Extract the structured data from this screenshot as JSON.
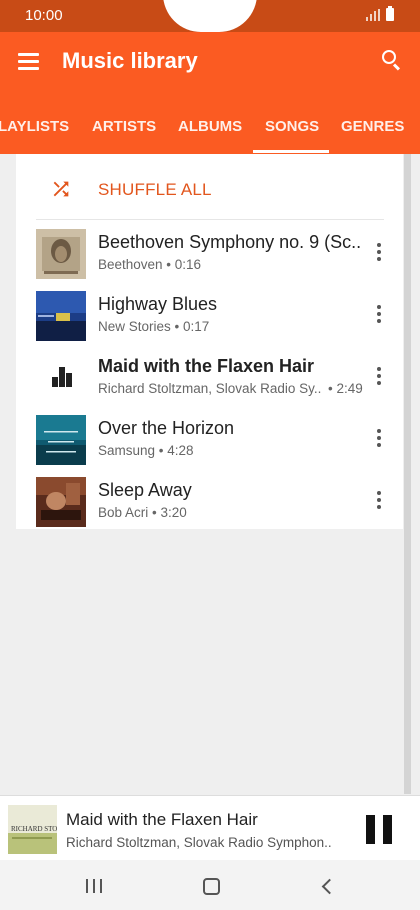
{
  "status_bar": {
    "time": "10:00"
  },
  "app_bar": {
    "title": "Music library",
    "tabs": [
      {
        "label": "LAYLISTS",
        "active": false
      },
      {
        "label": "ARTISTS",
        "active": false
      },
      {
        "label": "ALBUMS",
        "active": false
      },
      {
        "label": "SONGS",
        "active": true
      },
      {
        "label": "GENRES",
        "active": false
      }
    ]
  },
  "shuffle": {
    "label": "SHUFFLE ALL"
  },
  "songs": [
    {
      "title": "Beethoven Symphony no. 9 (Sc..",
      "subtitle": "Beethoven • 0:16",
      "duration": "",
      "playing": false
    },
    {
      "title": "Highway Blues",
      "subtitle": "New Stories • 0:17",
      "duration": "",
      "playing": false
    },
    {
      "title": "Maid with the Flaxen Hair",
      "subtitle": "Richard Stoltzman, Slovak Radio Sy..",
      "duration": "• 2:49",
      "playing": true
    },
    {
      "title": "Over the Horizon",
      "subtitle": "Samsung • 4:28",
      "duration": "",
      "playing": false
    },
    {
      "title": "Sleep Away",
      "subtitle": "Bob Acri • 3:20",
      "duration": "",
      "playing": false
    }
  ],
  "mini_player": {
    "title": "Maid with the Flaxen Hair",
    "subtitle": "Richard Stoltzman, Slovak Radio Symphon..",
    "album_art_text": "RICHARD STOLTZMAN"
  },
  "colors": {
    "status_bar": "#c84b16",
    "app_bar": "#fb5b22",
    "accent": "#e2561d"
  },
  "icons": {
    "menu": "hamburger-icon",
    "search": "search-icon",
    "shuffle": "shuffle-icon",
    "more": "more-vert-icon",
    "now_playing": "equalizer-icon",
    "pause": "pause-icon"
  }
}
